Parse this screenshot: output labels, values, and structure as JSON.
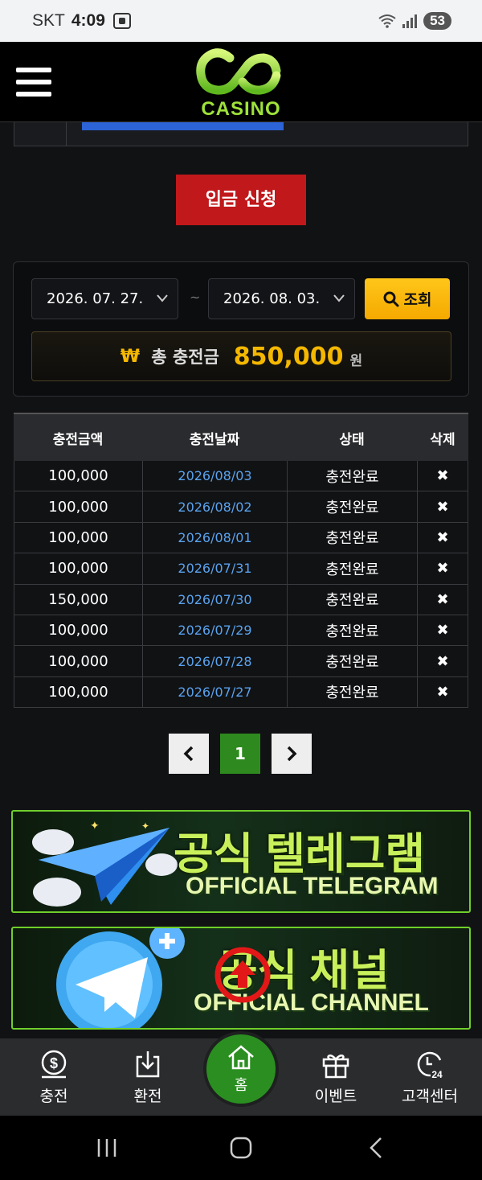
{
  "status_bar": {
    "carrier": "SKT",
    "time": "4:09",
    "battery": "53"
  },
  "header": {
    "logo_text": "CASINO",
    "logo_color": "#9ee23a"
  },
  "deposit_button": {
    "label": "입금 신청"
  },
  "filter": {
    "date_from": "2026. 07. 27.",
    "date_to": "2026. 08. 03.",
    "separator": "~",
    "search_label": "조회"
  },
  "total": {
    "currency_symbol": "₩",
    "label": "총 충전금",
    "amount": "850,000",
    "unit": "원"
  },
  "table": {
    "headers": [
      "충전금액",
      "충전날짜",
      "상태",
      "삭제"
    ],
    "rows": [
      {
        "amount": "100,000",
        "date": "2026/08/03",
        "status": "충전완료",
        "delete": "✖"
      },
      {
        "amount": "100,000",
        "date": "2026/08/02",
        "status": "충전완료",
        "delete": "✖"
      },
      {
        "amount": "100,000",
        "date": "2026/08/01",
        "status": "충전완료",
        "delete": "✖"
      },
      {
        "amount": "100,000",
        "date": "2026/07/31",
        "status": "충전완료",
        "delete": "✖"
      },
      {
        "amount": "150,000",
        "date": "2026/07/30",
        "status": "충전완료",
        "delete": "✖"
      },
      {
        "amount": "100,000",
        "date": "2026/07/29",
        "status": "충전완료",
        "delete": "✖"
      },
      {
        "amount": "100,000",
        "date": "2026/07/28",
        "status": "충전완료",
        "delete": "✖"
      },
      {
        "amount": "100,000",
        "date": "2026/07/27",
        "status": "충전완료",
        "delete": "✖"
      }
    ]
  },
  "pagination": {
    "prev": "‹",
    "current": "1",
    "next": "›"
  },
  "banners": [
    {
      "title_ko": "공식 텔레그램",
      "title_en": "OFFICIAL TELEGRAM"
    },
    {
      "title_ko": "공식 채널",
      "title_en": "OFFICIAL CHANNEL"
    }
  ],
  "bottom_nav": {
    "items": [
      {
        "label": "충전",
        "icon": "dollar-coin-icon"
      },
      {
        "label": "환전",
        "icon": "download-tray-icon"
      },
      {
        "label": "홈",
        "icon": "home-icon"
      },
      {
        "label": "이벤트",
        "icon": "gift-icon"
      },
      {
        "label": "고객센터",
        "icon": "support-24-icon"
      }
    ]
  },
  "colors": {
    "accent_red": "#c0181b",
    "accent_gold": "#f5b800",
    "accent_green": "#2e8a1e",
    "link_blue": "#5aa3ef"
  }
}
